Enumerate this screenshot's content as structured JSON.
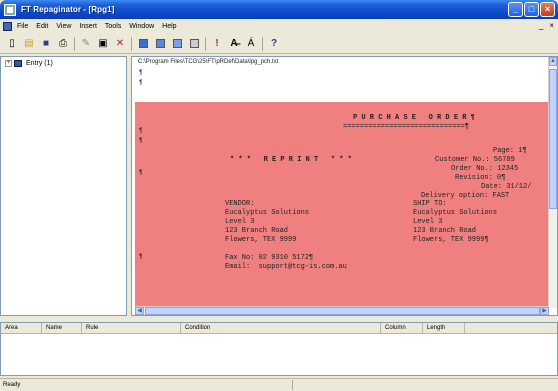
{
  "window": {
    "title": "FT Repaginator - [Rpg1]"
  },
  "menu": [
    "File",
    "Edit",
    "View",
    "Insert",
    "Tools",
    "Window",
    "Help"
  ],
  "mdi_controls": [
    "_",
    "×"
  ],
  "toolbar": {
    "icons": [
      "new-icon",
      "open-icon",
      "save-icon",
      "print-icon",
      "edit-icon",
      "properties-icon",
      "delete-icon",
      "view1-icon",
      "view2-icon",
      "view3-icon",
      "view4-icon",
      "run-icon",
      "font-icon",
      "font-size-icon",
      "help-icon"
    ],
    "glyphs": {
      "new": "▯",
      "open": "▤",
      "save": "■",
      "print": "⎙",
      "edit": "✎",
      "properties": "▣",
      "delete": "✕",
      "run": "!",
      "font": "A̶",
      "fontsize": "Á",
      "help": "?"
    }
  },
  "tree": {
    "expander": "+",
    "item": "Entry (1)"
  },
  "document": {
    "path": "C:\\Program Files\\TCG\\25\\FT\\pRDef\\Data\\lpg_pch.txt",
    "para": "¶",
    "lines": {
      "po_title": "P U R C H A S E   O R D E R ¶",
      "po_rule": "=============================¶",
      "page": "Page: 1¶",
      "reprint": "* * *   R E P R I N T   * * *",
      "customer": "Customer No.: 56789",
      "order": "Order No.: 12345",
      "revision": "Revision: 0¶",
      "date": "Date: 31/12/",
      "delivery": "Delivery option: FAST",
      "vendor_label": "VENDOR:",
      "shipto_label": "SHIP TO:",
      "vendor_name": "Eucalyptus Solutions",
      "shipto_name": "Eucalyptus Solutions",
      "vendor_level": "Level 3",
      "shipto_level": "Level 3",
      "vendor_street": "123 Branch Road",
      "shipto_street": "123 Branch Road",
      "vendor_city": "Flowers, TEX 9999",
      "shipto_city": "Flowers, TEX 9999¶",
      "fax": "Fax No: 02 9310 5172¶",
      "email": "Email:  support@tcg-is.com.au"
    }
  },
  "grid": {
    "columns": [
      "Area",
      "Name",
      "Rule",
      "Condition",
      "Column",
      "Length"
    ]
  },
  "status": {
    "text": "Ready"
  },
  "colors": {
    "highlight": "#f08080",
    "title_blue": "#0a49c8"
  }
}
